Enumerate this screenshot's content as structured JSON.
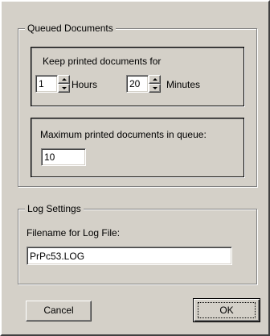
{
  "queued_documents": {
    "title": "Queued Documents",
    "keep_printed": {
      "label": "Keep printed documents for",
      "hours_value": "1",
      "hours_label": "Hours",
      "minutes_value": "20",
      "minutes_label": "Minutes"
    },
    "max_queue": {
      "label": "Maximum printed documents in queue:",
      "value": "10"
    }
  },
  "log_settings": {
    "title": "Log Settings",
    "filename_label": "Filename for Log File:",
    "filename_value": "PrPc53.LOG"
  },
  "buttons": {
    "cancel": "Cancel",
    "ok": "OK"
  }
}
